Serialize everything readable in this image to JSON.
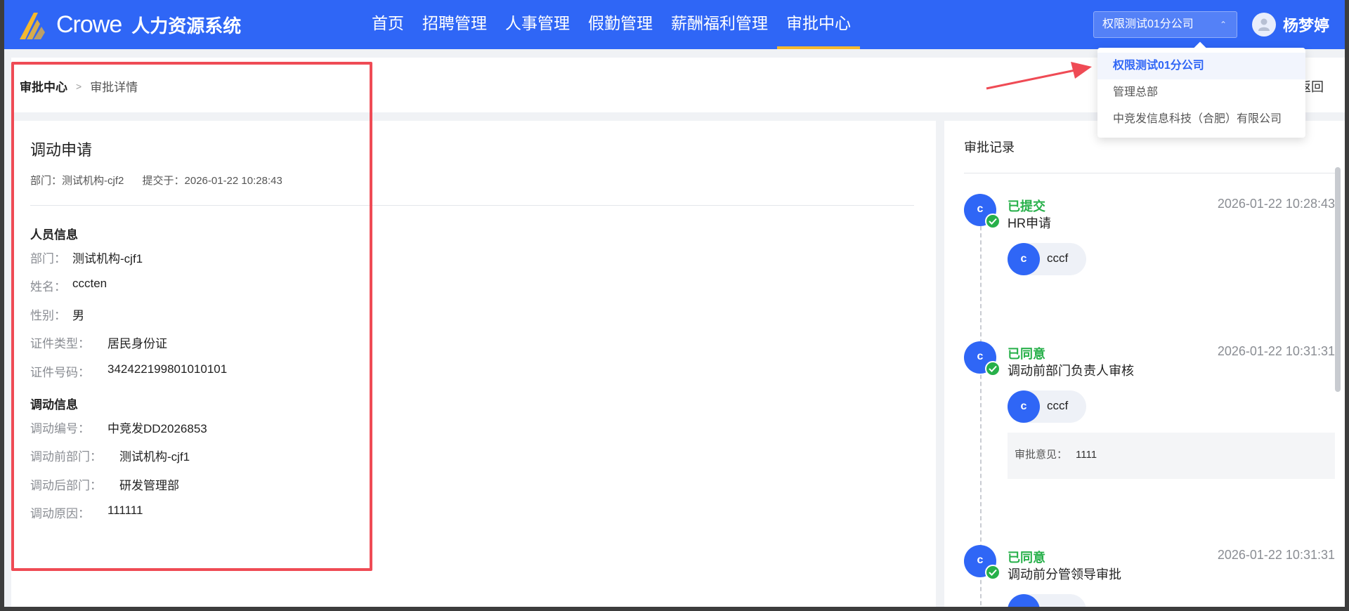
{
  "header": {
    "logo_text": "Crowe",
    "system_name": "人力资源系统",
    "nav": [
      {
        "label": "首页"
      },
      {
        "label": "招聘管理"
      },
      {
        "label": "人事管理"
      },
      {
        "label": "假勤管理"
      },
      {
        "label": "薪酬福利管理"
      },
      {
        "label": "审批中心",
        "active": true
      }
    ],
    "company_select": "权限测试01分公司",
    "user_name": "杨梦婷"
  },
  "company_dropdown": {
    "options": [
      "权限测试01分公司",
      "管理总部",
      "中竞发信息科技（合肥）有限公司"
    ],
    "selected_index": 0
  },
  "breadcrumb": {
    "root": "审批中心",
    "current": "审批详情",
    "back": "返回"
  },
  "application": {
    "title": "调动申请",
    "department": "部门：测试机构-cjf2",
    "submitted": "提交于：2026-01-22 10:28:43",
    "personnel_section": "人员信息",
    "personnel": [
      {
        "label": "部门：",
        "value": "测试机构-cjf1"
      },
      {
        "label": "姓名：",
        "value": "cccten"
      },
      {
        "label": "性别：",
        "value": "男"
      },
      {
        "label": "证件类型：",
        "value": "居民身份证"
      },
      {
        "label": "证件号码：",
        "value": "342422199801010101"
      }
    ],
    "transfer_section": "调动信息",
    "transfer": [
      {
        "label": "调动编号：",
        "value": "中竞发DD2026853"
      },
      {
        "label": "调动前部门：",
        "value": "测试机构-cjf1"
      },
      {
        "label": "调动后部门：",
        "value": "研发管理部"
      },
      {
        "label": "调动原因：",
        "value": "111111"
      }
    ]
  },
  "approval_records": {
    "title": "审批记录",
    "items": [
      {
        "avatar": "c",
        "status": "已提交",
        "time": "2026-01-22 10:28:43",
        "step": "HR申请",
        "person_avatar": "c",
        "person": "cccf"
      },
      {
        "avatar": "c",
        "status": "已同意",
        "time": "2026-01-22 10:31:31",
        "step": "调动前部门负责人审核",
        "person_avatar": "c",
        "person": "cccf",
        "comment_label": "审批意见：",
        "comment": "1111"
      },
      {
        "avatar": "c",
        "status": "已同意",
        "time": "2026-01-22 10:31:31",
        "step": "调动前分管领导审批"
      }
    ]
  },
  "colors": {
    "primary": "#2f66f6",
    "nav_active_underline": "#f5b82e",
    "success": "#27b04a",
    "annotation_red": "#ef4b55"
  }
}
